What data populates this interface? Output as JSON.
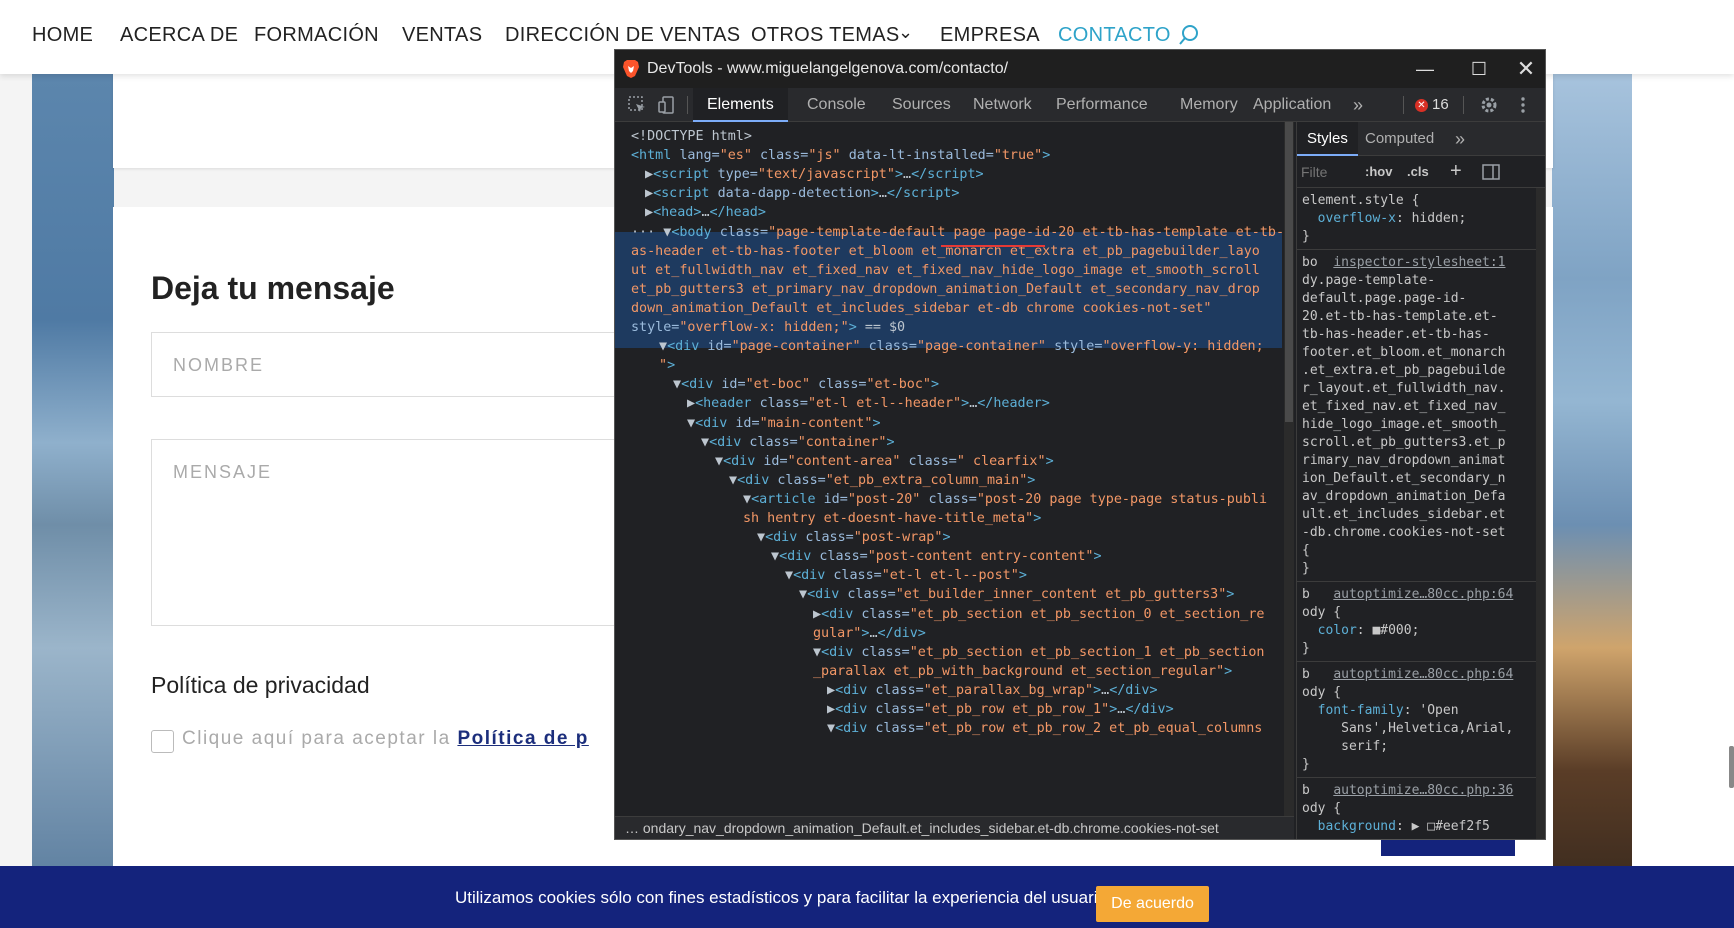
{
  "nav": {
    "items": [
      "HOME",
      "ACERCA DE",
      "FORMACIÓN",
      "VENTAS",
      "DIRECCIÓN DE VENTAS",
      "OTROS TEMAS",
      "EMPRESA",
      "CONTACTO"
    ],
    "dropdown_indicator": "⌄",
    "accent": "#2ea3c9"
  },
  "form": {
    "title": "Deja tu mensaje",
    "name_placeholder": "NOMBRE",
    "message_placeholder": "MENSAJE",
    "privacy_title": "Política de privacidad",
    "privacy_text": "Clique aquí para aceptar la ",
    "privacy_link": "Política de p"
  },
  "cookie": {
    "text": "Utilizamos cookies sólo con fines estadísticos y para facilitar la experiencia del usuario.",
    "button": "De acuerdo",
    "bar_color": "#14237c",
    "button_color": "#f4a836"
  },
  "devtools": {
    "title": "DevTools - www.miguelangelgenova.com/contacto/",
    "tabs": [
      "Elements",
      "Console",
      "Sources",
      "Network",
      "Performance",
      "Memory",
      "Application"
    ],
    "more_tabs": "»",
    "error_count": "16",
    "styles_tabs": [
      "Styles",
      "Computed"
    ],
    "filter_placeholder": "Filte",
    "hov": ":hov",
    "cls": ".cls",
    "breadcrumb_dots": "…",
    "breadcrumb": "ondary_nav_dropdown_animation_Default.et_includes_sidebar.et-db.chrome.cookies-not-set",
    "dom_lines": [
      {
        "indent": 0,
        "html": "<span class='c'>&lt;!DOCTYPE html&gt;</span>"
      },
      {
        "indent": 0,
        "html": "<span class='t'>&lt;html</span> <span class='a'>lang=</span><span class='v'>\"es\"</span> <span class='a'>class=</span><span class='v'>\"js\"</span> <span class='a'>data-lt-installed=</span><span class='v'>\"true\"</span><span class='t'>&gt;</span>"
      },
      {
        "indent": 1,
        "html": "<span class='c'>▶</span><span class='t'>&lt;script</span> <span class='a'>type=</span><span class='v'>\"text/javascript\"</span><span class='t'>&gt;</span><span class='c'>…</span><span class='t'>&lt;/script&gt;</span>"
      },
      {
        "indent": 1,
        "html": "<span class='c'>▶</span><span class='t'>&lt;script</span> <span class='a'>data-dapp-detection</span><span class='t'>&gt;</span><span class='c'>…</span><span class='t'>&lt;/script&gt;</span>"
      },
      {
        "indent": 1,
        "html": "<span class='c'>▶</span><span class='t'>&lt;head&gt;</span><span class='c'>…</span><span class='t'>&lt;/head&gt;</span>"
      },
      {
        "indent": 0,
        "html": "<span class='c'>··· ▼</span><span class='t'>&lt;body</span> <span class='a'>class=</span><span class='v'>\"page-template-default page page-id-20 et-tb-has-template et-tb-h</span>"
      },
      {
        "indent": 0,
        "html": "<span class='v'>as-header et-tb-has-footer et_bloom et_monarch et_extra et_pb_pagebuilder_layo</span>"
      },
      {
        "indent": 0,
        "html": "<span class='v'>ut et_fullwidth_nav et_fixed_nav et_fixed_nav_hide_logo_image et_smooth_scroll</span>"
      },
      {
        "indent": 0,
        "html": "<span class='v'>et_pb_gutters3 et_primary_nav_dropdown_animation_Default et_secondary_nav_drop</span>"
      },
      {
        "indent": 0,
        "html": "<span class='v'>down_animation_Default et_includes_sidebar et-db chrome cookies-not-set\"</span>"
      },
      {
        "indent": 0,
        "html": "<span class='a'>style=</span><span class='v'>\"overflow-x: hidden;\"</span><span class='t'>&gt;</span> <span class='c'>== $0</span>"
      },
      {
        "indent": 2,
        "html": "<span class='c'>▼</span><span class='t'>&lt;div</span> <span class='a'>id=</span><span class='v'>\"page-container\"</span> <span class='a'>class=</span><span class='v'>\"page-container\"</span> <span class='a'>style=</span><span class='v'>\"overflow-y: hidden;</span>"
      },
      {
        "indent": 2,
        "html": "<span class='v'>\"</span><span class='t'>&gt;</span>"
      },
      {
        "indent": 3,
        "html": "<span class='c'>▼</span><span class='t'>&lt;div</span> <span class='a'>id=</span><span class='v'>\"et-boc\"</span> <span class='a'>class=</span><span class='v'>\"et-boc\"</span><span class='t'>&gt;</span>"
      },
      {
        "indent": 4,
        "html": "<span class='c'>▶</span><span class='t'>&lt;header</span> <span class='a'>class=</span><span class='v'>\"et-l et-l--header\"</span><span class='t'>&gt;</span><span class='c'>…</span><span class='t'>&lt;/header&gt;</span>"
      },
      {
        "indent": 4,
        "html": "<span class='c'>▼</span><span class='t'>&lt;div</span> <span class='a'>id=</span><span class='v'>\"main-content\"</span><span class='t'>&gt;</span>"
      },
      {
        "indent": 5,
        "html": "<span class='c'>▼</span><span class='t'>&lt;div</span> <span class='a'>class=</span><span class='v'>\"container\"</span><span class='t'>&gt;</span>"
      },
      {
        "indent": 6,
        "html": "<span class='c'>▼</span><span class='t'>&lt;div</span> <span class='a'>id=</span><span class='v'>\"content-area\"</span> <span class='a'>class=</span><span class='v'>\" clearfix\"</span><span class='t'>&gt;</span>"
      },
      {
        "indent": 7,
        "html": "<span class='c'>▼</span><span class='t'>&lt;div</span> <span class='a'>class=</span><span class='v'>\"et_pb_extra_column_main\"</span><span class='t'>&gt;</span>"
      },
      {
        "indent": 8,
        "html": "<span class='c'>▼</span><span class='t'>&lt;article</span> <span class='a'>id=</span><span class='v'>\"post-20\"</span> <span class='a'>class=</span><span class='v'>\"post-20 page type-page status-publi</span>"
      },
      {
        "indent": 8,
        "html": "<span class='v'>sh hentry et-doesnt-have-title_meta\"</span><span class='t'>&gt;</span>"
      },
      {
        "indent": 9,
        "html": "<span class='c'>▼</span><span class='t'>&lt;div</span> <span class='a'>class=</span><span class='v'>\"post-wrap\"</span><span class='t'>&gt;</span>"
      },
      {
        "indent": 10,
        "html": "<span class='c'>▼</span><span class='t'>&lt;div</span> <span class='a'>class=</span><span class='v'>\"post-content entry-content\"</span><span class='t'>&gt;</span>"
      },
      {
        "indent": 11,
        "html": "<span class='c'>▼</span><span class='t'>&lt;div</span> <span class='a'>class=</span><span class='v'>\"et-l et-l--post\"</span><span class='t'>&gt;</span>"
      },
      {
        "indent": 12,
        "html": "<span class='c'>▼</span><span class='t'>&lt;div</span> <span class='a'>class=</span><span class='v'>\"et_builder_inner_content et_pb_gutters3\"</span><span class='t'>&gt;</span>"
      },
      {
        "indent": 13,
        "html": "<span class='c'>▶</span><span class='t'>&lt;div</span> <span class='a'>class=</span><span class='v'>\"et_pb_section et_pb_section_0 et_section_re</span>"
      },
      {
        "indent": 13,
        "html": "<span class='v'>gular\"</span><span class='t'>&gt;</span><span class='c'>…</span><span class='t'>&lt;/div&gt;</span>"
      },
      {
        "indent": 13,
        "html": "<span class='c'>▼</span><span class='t'>&lt;div</span> <span class='a'>class=</span><span class='v'>\"et_pb_section et_pb_section_1 et_pb_section</span>"
      },
      {
        "indent": 13,
        "html": "<span class='v'>_parallax et_pb_with_background et_section_regular\"</span><span class='t'>&gt;</span>"
      },
      {
        "indent": 14,
        "html": "<span class='c'>▶</span><span class='t'>&lt;div</span> <span class='a'>class=</span><span class='v'>\"et_parallax_bg_wrap\"</span><span class='t'>&gt;</span><span class='c'>…</span><span class='t'>&lt;/div&gt;</span>"
      },
      {
        "indent": 14,
        "html": "<span class='c'>▶</span><span class='t'>&lt;div</span> <span class='a'>class=</span><span class='v'>\"et_pb_row et_pb_row_1\"</span><span class='t'>&gt;</span><span class='c'>…</span><span class='t'>&lt;/div&gt;</span>"
      },
      {
        "indent": 14,
        "html": "<span class='c'>▼</span><span class='t'>&lt;div</span> <span class='a'>class=</span><span class='v'>\"et_pb_row et_pb_row_2 et_pb_equal_columns</span>"
      }
    ],
    "style_lines": [
      "element.style {",
      "  <span class='prop'>overflow-x</span>: hidden;",
      "}",
      "SEP",
      "bo  <span class='link'>inspector-stylesheet:1</span>",
      "dy.page-template-",
      "default.page.page-id-",
      "20.et-tb-has-template.et-",
      "tb-has-header.et-tb-has-",
      "footer.et_bloom.et_monarch",
      ".et_extra.et_pb_pagebuilde",
      "r_layout.et_fullwidth_nav.",
      "et_fixed_nav.et_fixed_nav_",
      "hide_logo_image.et_smooth_",
      "scroll.et_pb_gutters3.et_p",
      "rimary_nav_dropdown_animat",
      "ion_Default.et_secondary_n",
      "av_dropdown_animation_Defa",
      "ult.et_includes_sidebar.et",
      "-db.chrome.cookies-not-set",
      "{",
      "}",
      "SEP",
      "b   <span class='link'>autoptimize…80cc.php:64</span>",
      "ody {",
      "  <span class='prop'>color</span>: ■#000;",
      "}",
      "SEP",
      "b   <span class='link'>autoptimize…80cc.php:64</span>",
      "ody {",
      "  <span class='prop'>font-family</span>: 'Open",
      "     Sans',Helvetica,Arial,",
      "     serif;",
      "}",
      "SEP",
      "b   <span class='link'>autoptimize…80cc.php:36</span>",
      "ody {",
      "  <span class='prop'>background</span>: ▶ □#eef2f5"
    ]
  }
}
